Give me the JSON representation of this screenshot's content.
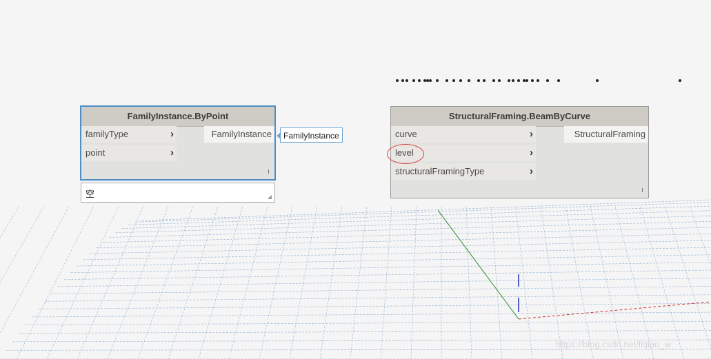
{
  "nodes": {
    "family_instance": {
      "title": "FamilyInstance.ByPoint",
      "inputs": [
        "familyType",
        "point"
      ],
      "output": "FamilyInstance",
      "preview_value": "FamilyInstance",
      "watch_value": "空"
    },
    "structural_framing": {
      "title": "StructuralFraming.BeamByCurve",
      "inputs": [
        "curve",
        "level",
        "structuralFramingType"
      ],
      "output": "StructuralFraming"
    }
  },
  "watermark": "https://blog.csdn.net/liqiao_w",
  "icons": {
    "input_port": "chevron-right-icon",
    "resize": "resize-grip-icon"
  },
  "colors": {
    "selection_border": "#4e8ec8",
    "annotation": "#d94040",
    "grid": "#9ab6d4",
    "x_axis": "#d43030",
    "y_axis": "#2a8a2a",
    "z_axis": "#2030c0"
  }
}
